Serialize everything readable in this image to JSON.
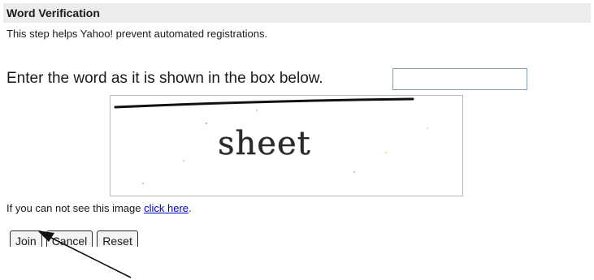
{
  "section": {
    "title": "Word Verification",
    "description": "This step helps Yahoo! prevent automated registrations."
  },
  "verification": {
    "prompt": "Enter the word as it is shown in the box below.",
    "input_value": "",
    "captcha_word": "sheet"
  },
  "fallback": {
    "text": "If you can not see this image ",
    "link_text": "click here",
    "suffix": "."
  },
  "buttons": {
    "join": "Join",
    "cancel": "Cancel",
    "reset": "Reset"
  }
}
